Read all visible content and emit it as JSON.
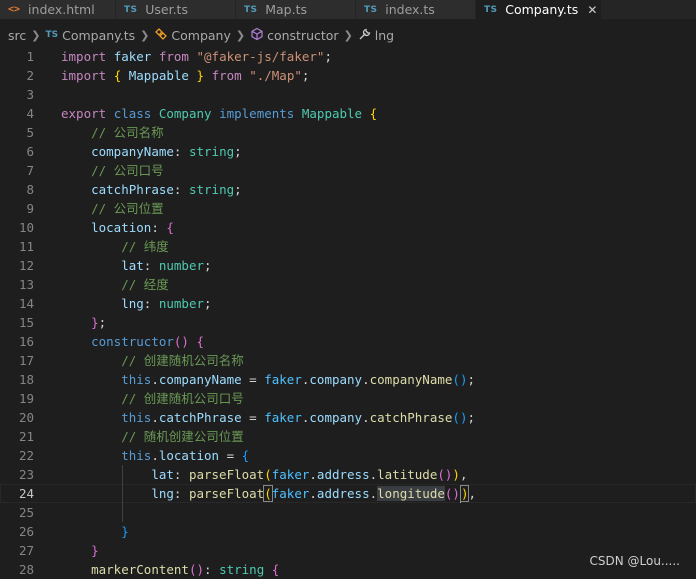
{
  "tabs": [
    {
      "icon": "<>",
      "label": "index.html",
      "kind": "html"
    },
    {
      "icon": "TS",
      "label": "User.ts",
      "kind": "ts"
    },
    {
      "icon": "TS",
      "label": "Map.ts",
      "kind": "ts"
    },
    {
      "icon": "TS",
      "label": "index.ts",
      "kind": "ts"
    },
    {
      "icon": "TS",
      "label": "Company.ts",
      "kind": "ts",
      "active": true,
      "close": "✕"
    }
  ],
  "breadcrumb": {
    "folder": "src",
    "file_icon": "TS",
    "file": "Company.ts",
    "class": "Company",
    "method": "constructor",
    "property": "lng"
  },
  "code": {
    "lines": [
      "import faker from \"@faker-js/faker\";",
      "import { Mappable } from \"./Map\";",
      "",
      "export class Company implements Mappable {",
      "    // 公司名称",
      "    companyName: string;",
      "    // 公司口号",
      "    catchPhrase: string;",
      "    // 公司位置",
      "    location: {",
      "        // 纬度",
      "        lat: number;",
      "        // 经度",
      "        lng: number;",
      "    };",
      "    constructor() {",
      "        // 创建随机公司名称",
      "        this.companyName = faker.company.companyName();",
      "        // 创建随机公司口号",
      "        this.catchPhrase = faker.company.catchPhrase();",
      "        // 随机创建公司位置",
      "        this.location = {",
      "            lat: parseFloat(faker.address.latitude()),",
      "            lng: parseFloat(faker.address.longitude()),",
      "",
      "        }",
      "    }",
      "    markerContent(): string {"
    ],
    "first_line_number": 1,
    "current_line": 24
  },
  "watermark": "CSDN @Lou.....",
  "colors": {
    "background": "#1e1e1e",
    "keyword": "#569cd6",
    "control": "#c586c0",
    "string": "#ce9178",
    "type": "#4ec9b0",
    "variable": "#9cdcfe",
    "function": "#dcdcaa",
    "comment": "#6a9955"
  }
}
